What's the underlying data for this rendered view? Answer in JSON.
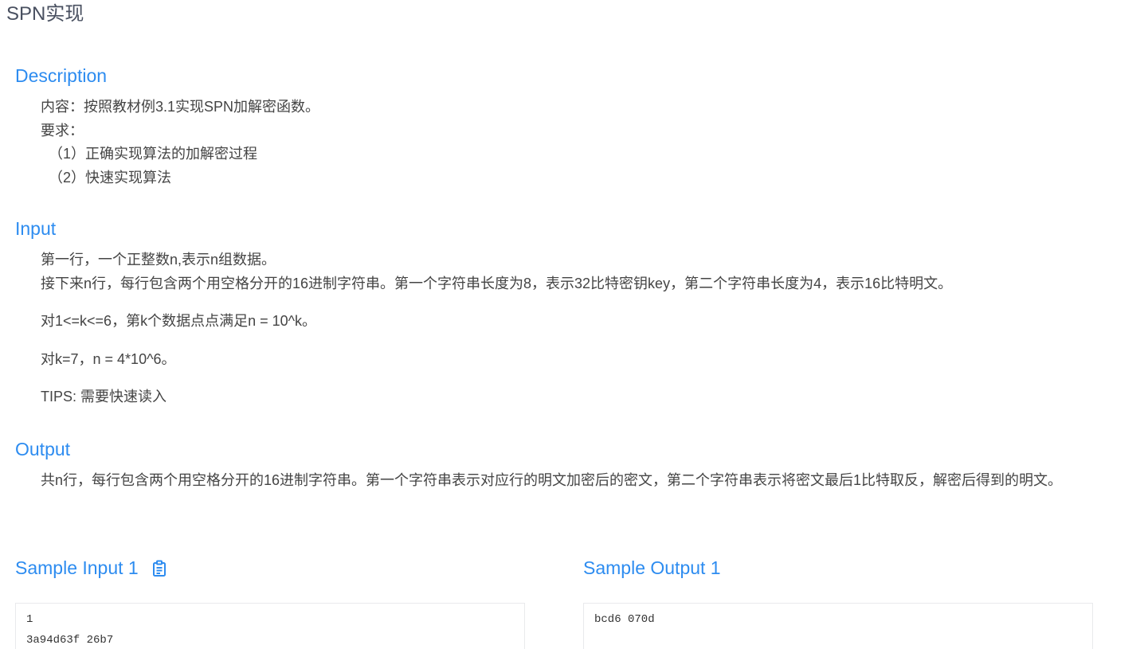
{
  "problem": {
    "title": "SPN实现"
  },
  "description": {
    "heading": "Description",
    "lines": [
      "内容：按照教材例3.1实现SPN加解密函数。",
      "要求：",
      "（1）正确实现算法的加解密过程",
      "（2）快速实现算法"
    ]
  },
  "input": {
    "heading": "Input",
    "lines": [
      "第一行，一个正整数n,表示n组数据。",
      "接下来n行，每行包含两个用空格分开的16进制字符串。第一个字符串长度为8，表示32比特密钥key，第二个字符串长度为4，表示16比特明文。",
      "对1<=k<=6，第k个数据点点满足n = 10^k。",
      "对k=7，n = 4*10^6。",
      "TIPS: 需要快速读入"
    ]
  },
  "output": {
    "heading": "Output",
    "text": "共n行，每行包含两个用空格分开的16进制字符串。第一个字符串表示对应行的明文加密后的密文，第二个字符串表示将密文最后1比特取反，解密后得到的明文。"
  },
  "samples": {
    "input_heading": "Sample Input 1",
    "output_heading": "Sample Output 1",
    "input_lines": [
      "1",
      "3a94d63f 26b7"
    ],
    "output_lines": [
      "bcd6 070d"
    ]
  },
  "icons": {
    "copy": "clipboard-icon"
  },
  "colors": {
    "accent": "#2d8cf0",
    "text": "#444444",
    "border": "#e9eaec"
  }
}
